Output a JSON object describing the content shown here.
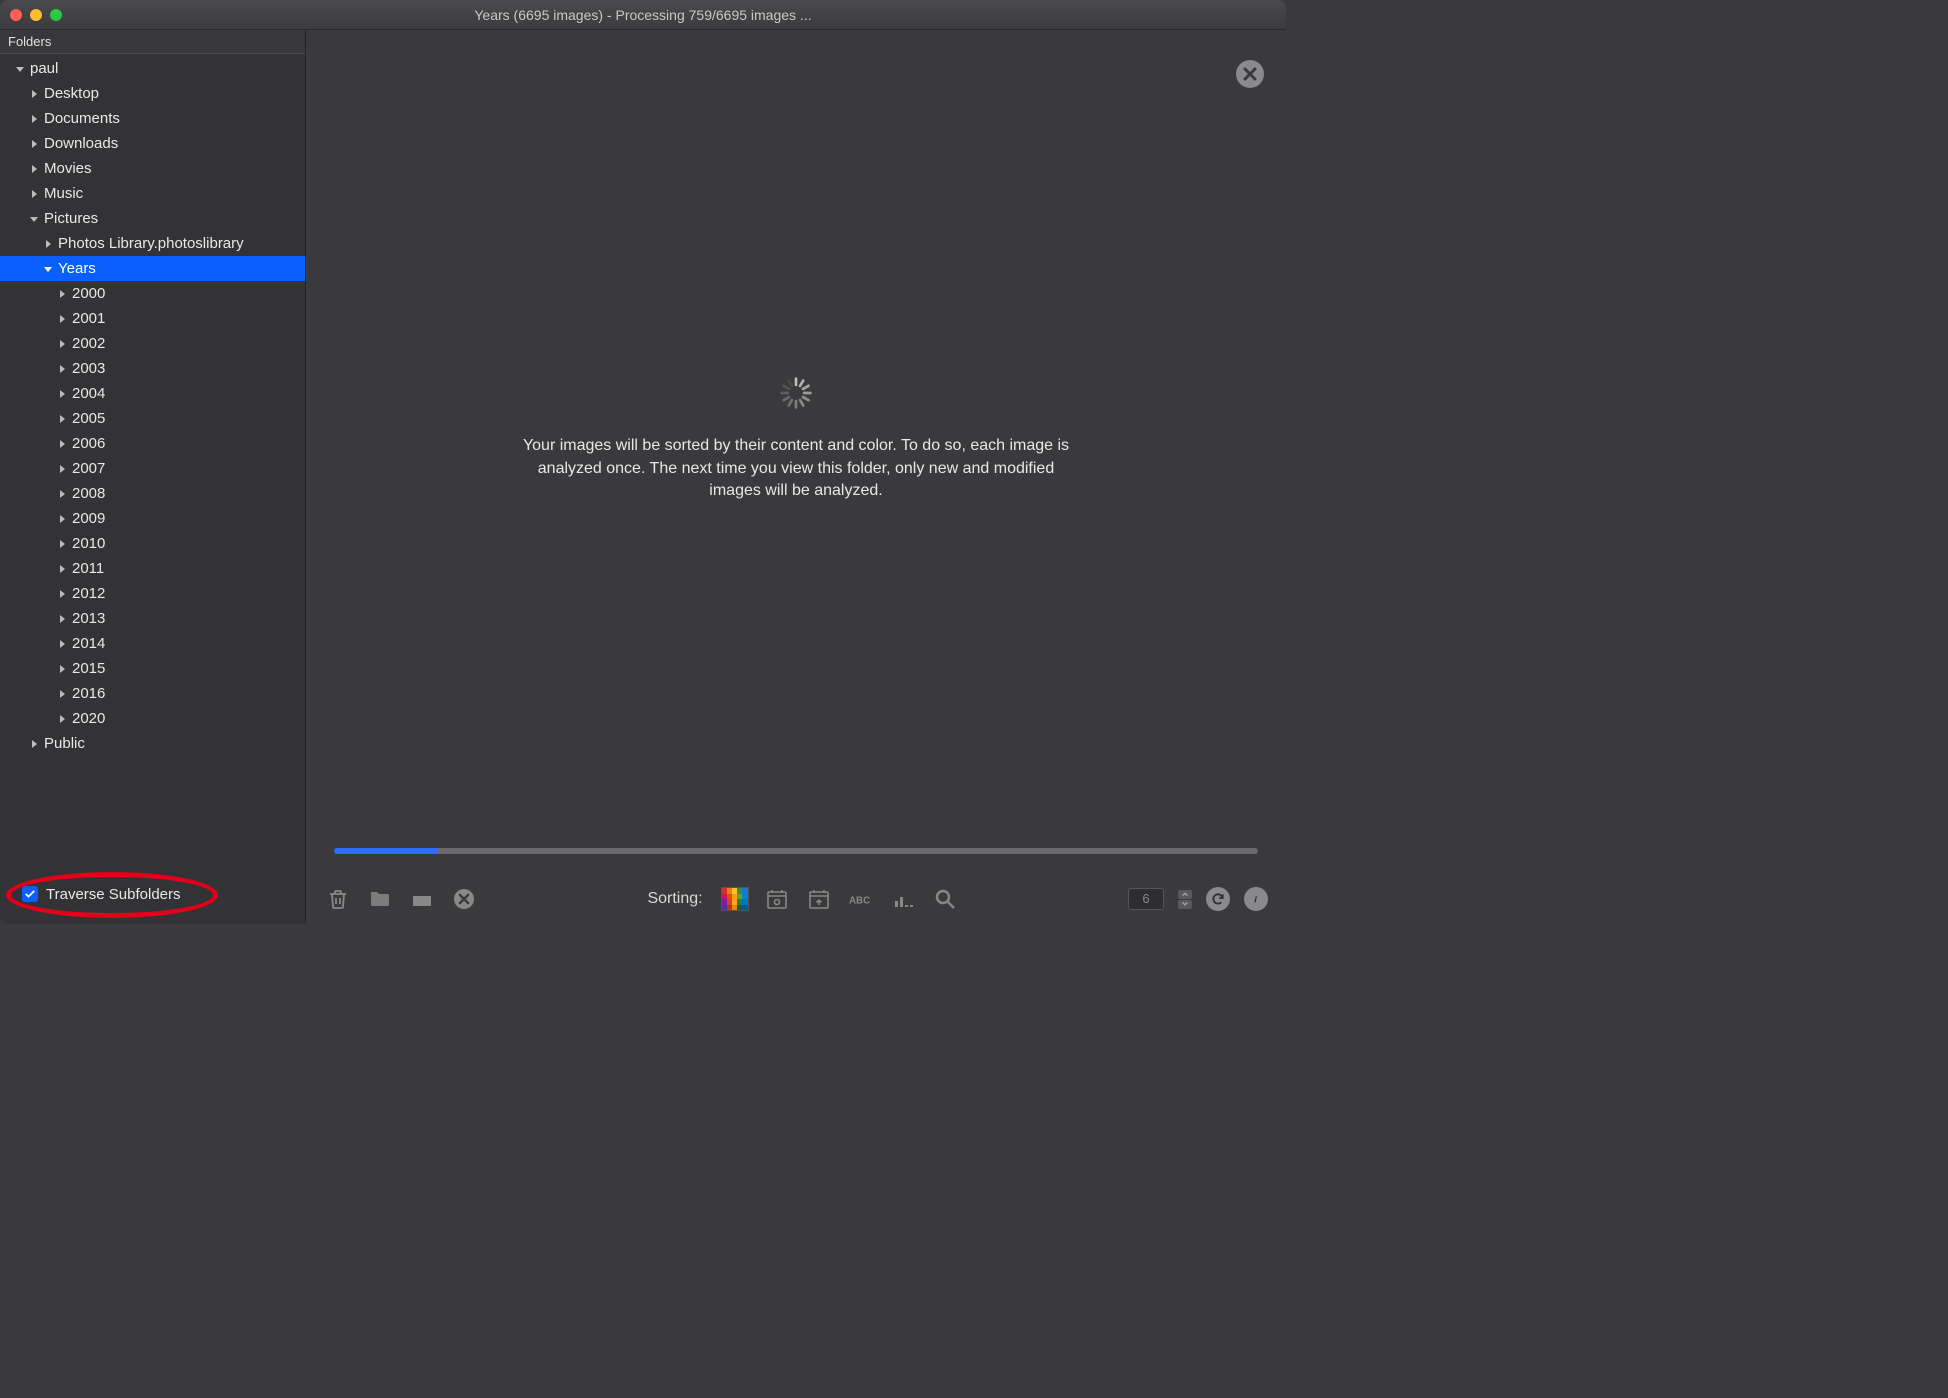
{
  "title": "Years (6695 images) - Processing 759/6695 images ...",
  "sidebar": {
    "header": "Folders",
    "traverse_label": "Traverse Subfolders",
    "traverse_checked": true,
    "tree": [
      {
        "label": "paul",
        "level": 0,
        "expanded": true,
        "selected": false
      },
      {
        "label": "Desktop",
        "level": 1,
        "expanded": false,
        "selected": false
      },
      {
        "label": "Documents",
        "level": 1,
        "expanded": false,
        "selected": false
      },
      {
        "label": "Downloads",
        "level": 1,
        "expanded": false,
        "selected": false
      },
      {
        "label": "Movies",
        "level": 1,
        "expanded": false,
        "selected": false
      },
      {
        "label": "Music",
        "level": 1,
        "expanded": false,
        "selected": false
      },
      {
        "label": "Pictures",
        "level": 1,
        "expanded": true,
        "selected": false
      },
      {
        "label": "Photos Library.photoslibrary",
        "level": 2,
        "expanded": false,
        "selected": false
      },
      {
        "label": "Years",
        "level": 2,
        "expanded": true,
        "selected": true
      },
      {
        "label": "2000",
        "level": 3,
        "expanded": false,
        "selected": false
      },
      {
        "label": "2001",
        "level": 3,
        "expanded": false,
        "selected": false
      },
      {
        "label": "2002",
        "level": 3,
        "expanded": false,
        "selected": false
      },
      {
        "label": "2003",
        "level": 3,
        "expanded": false,
        "selected": false
      },
      {
        "label": "2004",
        "level": 3,
        "expanded": false,
        "selected": false
      },
      {
        "label": "2005",
        "level": 3,
        "expanded": false,
        "selected": false
      },
      {
        "label": "2006",
        "level": 3,
        "expanded": false,
        "selected": false
      },
      {
        "label": "2007",
        "level": 3,
        "expanded": false,
        "selected": false
      },
      {
        "label": "2008",
        "level": 3,
        "expanded": false,
        "selected": false
      },
      {
        "label": "2009",
        "level": 3,
        "expanded": false,
        "selected": false
      },
      {
        "label": "2010",
        "level": 3,
        "expanded": false,
        "selected": false
      },
      {
        "label": "2011",
        "level": 3,
        "expanded": false,
        "selected": false
      },
      {
        "label": "2012",
        "level": 3,
        "expanded": false,
        "selected": false
      },
      {
        "label": "2013",
        "level": 3,
        "expanded": false,
        "selected": false
      },
      {
        "label": "2014",
        "level": 3,
        "expanded": false,
        "selected": false
      },
      {
        "label": "2015",
        "level": 3,
        "expanded": false,
        "selected": false
      },
      {
        "label": "2016",
        "level": 3,
        "expanded": false,
        "selected": false
      },
      {
        "label": "2020",
        "level": 3,
        "expanded": false,
        "selected": false
      },
      {
        "label": "Public",
        "level": 1,
        "expanded": false,
        "selected": false
      }
    ]
  },
  "main": {
    "info": "Your images will be sorted by their content and color. To do so, each image is analyzed once. The next time you view this folder, only new and modified images will be analyzed.",
    "progress_percent": 11.3
  },
  "toolbar": {
    "sorting_label": "Sorting:",
    "count": "6"
  }
}
